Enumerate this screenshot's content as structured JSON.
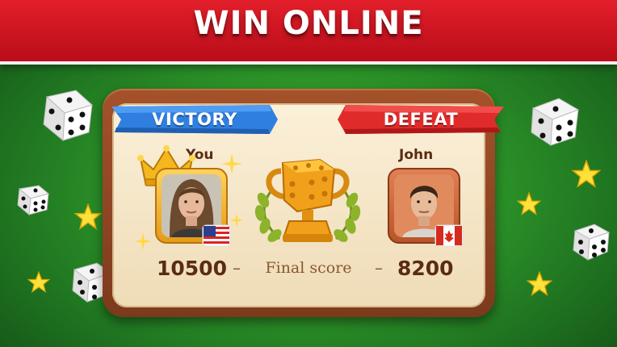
{
  "banner": {
    "title": "WIN ONLINE"
  },
  "result": {
    "left_ribbon": "VICTORY",
    "right_ribbon": "DEFEAT",
    "score_label": "Final score",
    "separator": "–"
  },
  "players": [
    {
      "name": "You",
      "score": "10500",
      "country_flag": "us-flag-icon",
      "has_crown": true
    },
    {
      "name": "John",
      "score": "8200",
      "country_flag": "canada-flag-icon",
      "has_crown": false
    }
  ],
  "colors": {
    "banner_red": "#d3141f",
    "victory_blue": "#2f7fe0",
    "defeat_red": "#e02b2b",
    "board_brown": "#8f4724",
    "panel_cream": "#f6e6c6",
    "trophy_gold": "#f0a01a",
    "table_green": "#2f9a2a"
  },
  "decorations": [
    "dice-icon",
    "star-icon",
    "trophy-icon",
    "laurel-icon",
    "crown-icon"
  ]
}
